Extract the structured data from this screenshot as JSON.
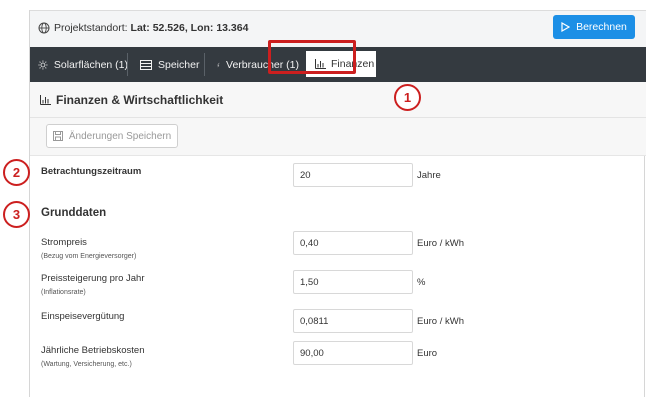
{
  "topbar": {
    "location_prefix": "Projektstandort:",
    "location_value": "Lat: 52.526, Lon: 13.364",
    "calc_button": "Berechnen"
  },
  "nav": {
    "tabs": [
      {
        "label": "Solarflächen (1)",
        "icon": "sun-icon"
      },
      {
        "label": "Speicher",
        "icon": "battery-icon"
      },
      {
        "label": "Verbraucher (1)",
        "icon": "bolt-icon"
      },
      {
        "label": "Finanzen",
        "icon": "bar-chart-icon",
        "active": true
      }
    ]
  },
  "section": {
    "title": "Finanzen & Wirtschaftlichkeit",
    "save_button": "Änderungen Speichern"
  },
  "fields": {
    "period": {
      "label": "Betrachtungszeitraum",
      "value": "20",
      "unit": "Jahre"
    },
    "group_title": "Grunddaten",
    "strompreis": {
      "label": "Strompreis",
      "sub": "(Bezug vom Energieversorger)",
      "value": "0,40",
      "unit": "Euro / kWh"
    },
    "preissteigerung": {
      "label": "Preissteigerung pro Jahr",
      "sub": "(Inflationsrate)",
      "value": "1,50",
      "unit": "%"
    },
    "einspeise": {
      "label": "Einspeisevergütung",
      "value": "0,0811",
      "unit": "Euro / kWh"
    },
    "betrieb": {
      "label": "Jährliche Betriebskosten",
      "sub": "(Wartung, Versicherung, etc.)",
      "value": "90,00",
      "unit": "Euro"
    }
  },
  "annotations": {
    "one": "1",
    "two": "2",
    "three": "3"
  },
  "colors": {
    "accent": "#1c8fe6",
    "navbar": "#343a40",
    "highlight": "#cc1f1f"
  }
}
